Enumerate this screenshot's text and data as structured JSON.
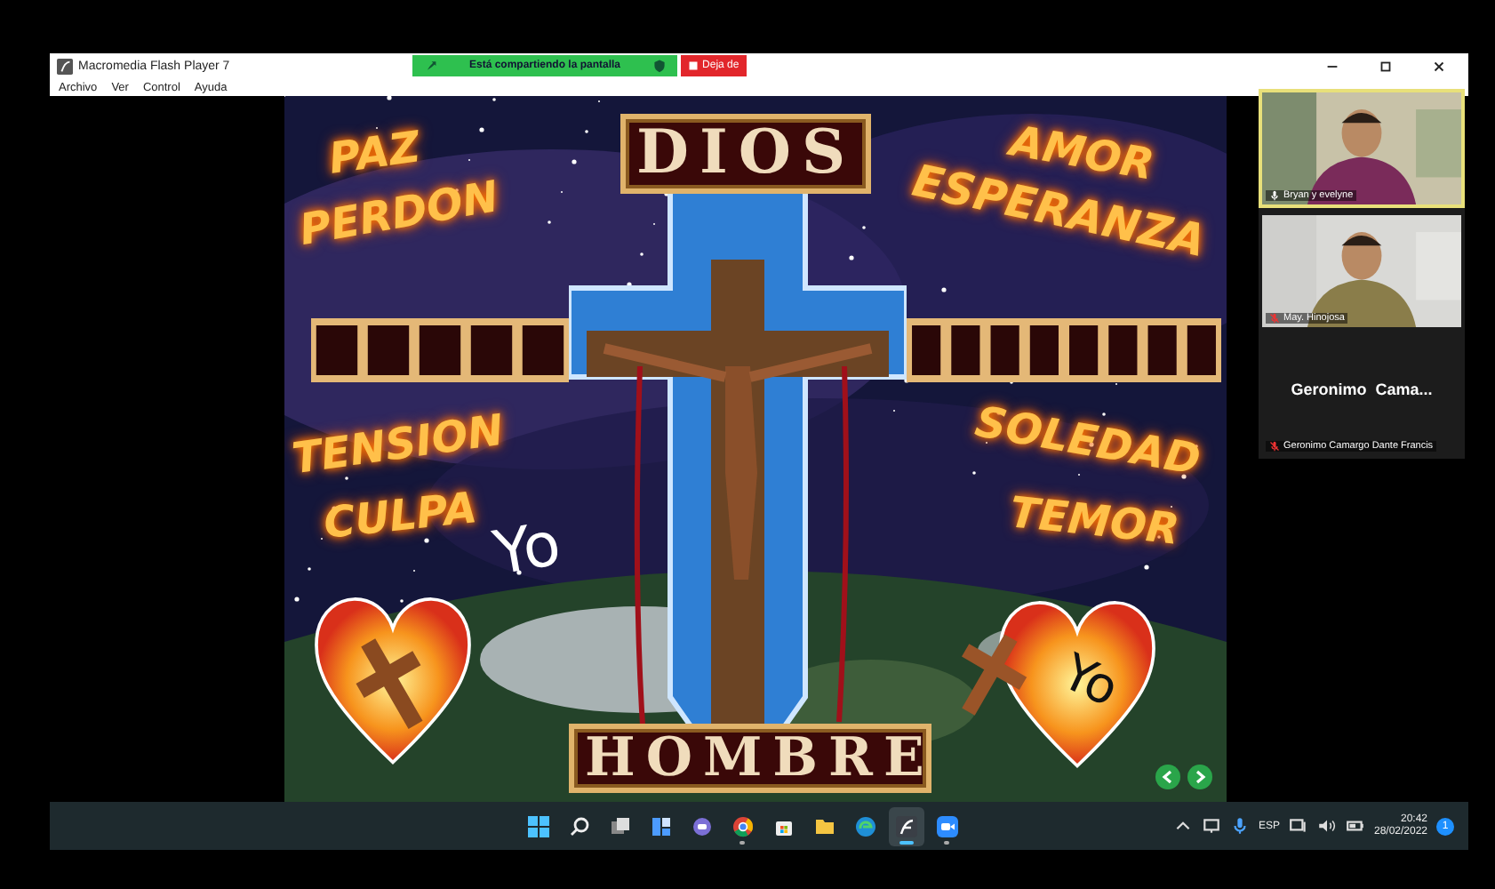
{
  "window": {
    "title": "Macromedia Flash Player 7",
    "menu": [
      "Archivo",
      "Ver",
      "Control",
      "Ayuda"
    ]
  },
  "share_banner": {
    "text": "Está compartiendo la pantalla",
    "stop_button": "Deja de"
  },
  "movie": {
    "top_word": "DIOS",
    "bottom_word": "HOMBRE",
    "words": [
      "PAZ",
      "PERDON",
      "AMOR",
      "ESPERANZA",
      "TENSION",
      "CULPA",
      "SOLEDAD",
      "TEMOR"
    ],
    "yo_labels": [
      "Yo",
      "Yo"
    ]
  },
  "participants": [
    {
      "kind": "video",
      "name": "Bryan y evelyne",
      "muted": false,
      "speaking": true
    },
    {
      "kind": "video",
      "name": "May. Hinojosa",
      "muted": true,
      "speaking": false
    },
    {
      "kind": "no_video",
      "display": "Geronimo  Cama...",
      "name": "Geronimo Camargo Dante Francis",
      "muted": true,
      "speaking": false
    }
  ],
  "taskbar": {
    "apps": [
      {
        "kind": "start",
        "open": false,
        "selected": false
      },
      {
        "kind": "search",
        "open": false,
        "selected": false
      },
      {
        "kind": "taskview",
        "open": false,
        "selected": false
      },
      {
        "kind": "widgets",
        "open": false,
        "selected": false
      },
      {
        "kind": "chat",
        "open": false,
        "selected": false
      },
      {
        "kind": "chrome",
        "open": true,
        "selected": false
      },
      {
        "kind": "store",
        "open": false,
        "selected": false
      },
      {
        "kind": "folder",
        "open": false,
        "selected": false
      },
      {
        "kind": "edge",
        "open": false,
        "selected": false
      },
      {
        "kind": "flash",
        "open": true,
        "selected": true
      },
      {
        "kind": "zoom",
        "open": true,
        "selected": false
      }
    ],
    "language": "ESP",
    "time": "20:42",
    "date": "28/02/2022",
    "notifications": "1"
  }
}
